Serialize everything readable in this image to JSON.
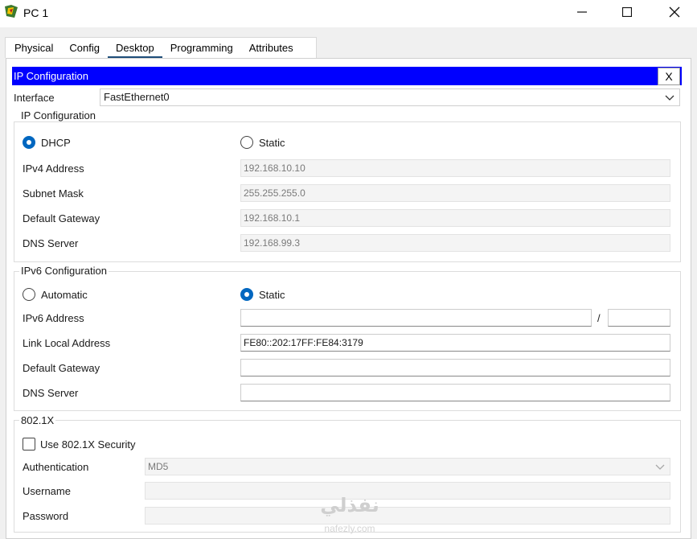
{
  "window": {
    "title": "PC 1",
    "minimize_label": "—",
    "maximize_label": "☐",
    "close_label": "✕"
  },
  "tabs": [
    {
      "label": "Physical"
    },
    {
      "label": "Config"
    },
    {
      "label": "Desktop"
    },
    {
      "label": "Programming"
    },
    {
      "label": "Attributes"
    }
  ],
  "active_tab": "Desktop",
  "ip_config_bar": {
    "title": "IP Configuration",
    "close_label": "X"
  },
  "interface": {
    "label": "Interface",
    "value": "FastEthernet0"
  },
  "ipv4": {
    "group_title": "IP Configuration",
    "dhcp_label": "DHCP",
    "static_label": "Static",
    "mode": "DHCP",
    "ipv4_address_label": "IPv4 Address",
    "ipv4_address": "192.168.10.10",
    "subnet_mask_label": "Subnet Mask",
    "subnet_mask": "255.255.255.0",
    "default_gateway_label": "Default Gateway",
    "default_gateway": "192.168.10.1",
    "dns_server_label": "DNS Server",
    "dns_server": "192.168.99.3"
  },
  "ipv6": {
    "group_title": "IPv6 Configuration",
    "automatic_label": "Automatic",
    "static_label": "Static",
    "mode": "Static",
    "ipv6_address_label": "IPv6 Address",
    "ipv6_address": "",
    "prefix_separator": "/",
    "prefix_length": "",
    "link_local_label": "Link Local Address",
    "link_local": "FE80::202:17FF:FE84:3179",
    "default_gateway_label": "Default Gateway",
    "default_gateway": "",
    "dns_server_label": "DNS Server",
    "dns_server": ""
  },
  "dot1x": {
    "group_title": "802.1X",
    "use_security_label": "Use 802.1X Security",
    "use_security_checked": false,
    "authentication_label": "Authentication",
    "authentication_value": "MD5",
    "username_label": "Username",
    "username": "",
    "password_label": "Password",
    "password": ""
  },
  "watermark": {
    "text": "نفذلي",
    "subtext": "nafezly.com"
  },
  "colors": {
    "title_bar_blue": "#0000ff",
    "radio_selected": "#0067c0",
    "tab_underline": "#1f4e79"
  }
}
